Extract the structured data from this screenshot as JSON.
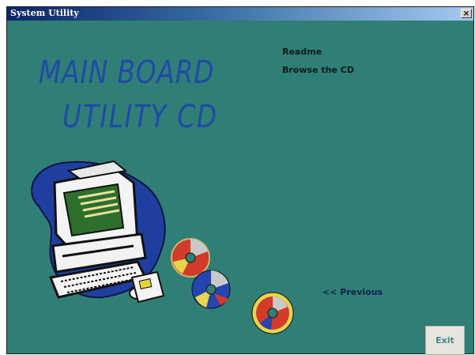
{
  "window": {
    "title": "System Utility",
    "close_glyph": "×"
  },
  "logo": {
    "line1": "MAIN BOARD",
    "line2": "UTILITY  CD"
  },
  "menu": {
    "readme": "Readme",
    "browse": "Browse the CD"
  },
  "nav": {
    "previous": "<< Previous"
  },
  "buttons": {
    "exit": "Exit"
  },
  "colors": {
    "background": "#2f7f77",
    "logo_text": "#1f4aa8",
    "exit_text": "#3c8a82"
  },
  "icons": [
    "computer-clipart-icon",
    "cd-disc-icon",
    "floppy-disk-icon"
  ]
}
